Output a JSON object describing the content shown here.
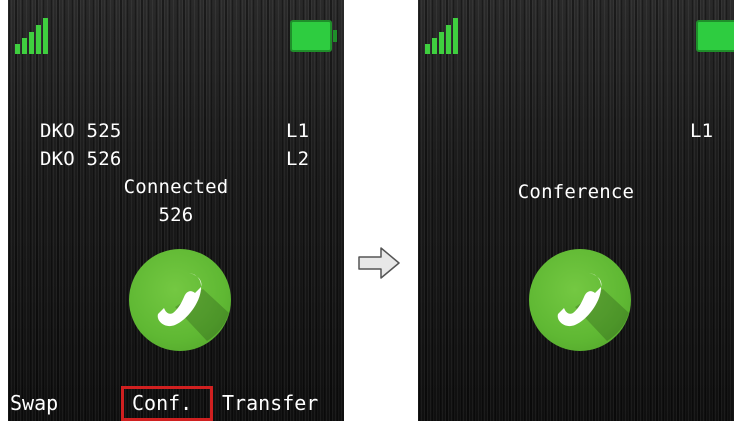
{
  "left_screen": {
    "status": {
      "signal_icon": "signal-bars-icon",
      "battery_icon": "battery-full-icon"
    },
    "lines": [
      {
        "name": "DKO 525",
        "line": "L1"
      },
      {
        "name": "DKO 526",
        "line": "L2"
      }
    ],
    "call_status": "Connected",
    "call_number": "526",
    "call_icon": "handset-icon",
    "softkeys": {
      "left": "Swap",
      "middle": "Conf.",
      "right": "Transfer"
    },
    "highlighted_softkey": "Conf."
  },
  "arrow_icon": "arrow-right-icon",
  "right_screen": {
    "status": {
      "signal_icon": "signal-bars-icon",
      "battery_icon": "battery-full-icon"
    },
    "line": "L1",
    "call_status": "Conference",
    "call_icon": "handset-icon"
  },
  "colors": {
    "signal_green": "#3fcf3f",
    "battery_green": "#2ecc40",
    "call_green": "#5fb833",
    "highlight_red": "#d02020"
  }
}
